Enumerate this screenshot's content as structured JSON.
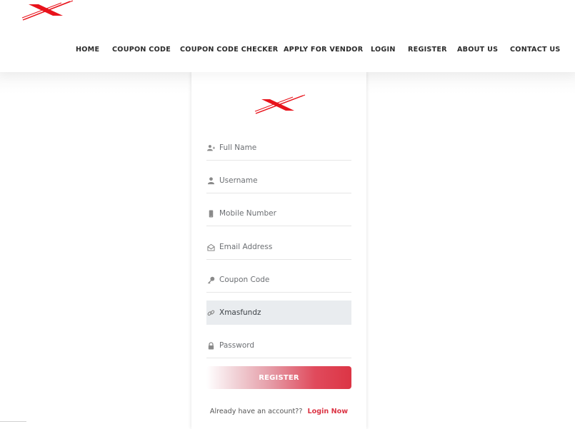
{
  "brand": {
    "logo_name": "X-logo",
    "accent_color": "#e8131b"
  },
  "nav": {
    "items": [
      {
        "label": "HOME"
      },
      {
        "label": "COUPON CODE"
      },
      {
        "label": "COUPON CODE CHECKER"
      },
      {
        "label": "APPLY FOR VENDOR"
      },
      {
        "label": "LOGIN"
      },
      {
        "label": "REGISTER"
      },
      {
        "label": "ABOUT US"
      },
      {
        "label": "CONTACT US"
      }
    ]
  },
  "form": {
    "fields": [
      {
        "icon": "user-plus-icon",
        "placeholder": "Full Name",
        "value": ""
      },
      {
        "icon": "user-icon",
        "placeholder": "Username",
        "value": ""
      },
      {
        "icon": "mobile-icon",
        "placeholder": "Mobile Number",
        "value": ""
      },
      {
        "icon": "envelope-open-icon",
        "placeholder": "Email Address",
        "value": ""
      },
      {
        "icon": "key-icon",
        "placeholder": "Coupon Code",
        "value": ""
      },
      {
        "icon": "link-icon",
        "placeholder": "",
        "value": "Xmasfundz"
      },
      {
        "icon": "lock-icon",
        "placeholder": "Password",
        "value": ""
      }
    ],
    "submit_label": "REGISTER",
    "submit_color": "#dc3545",
    "login_prompt": "Already have an account??",
    "login_link": "Login Now"
  }
}
